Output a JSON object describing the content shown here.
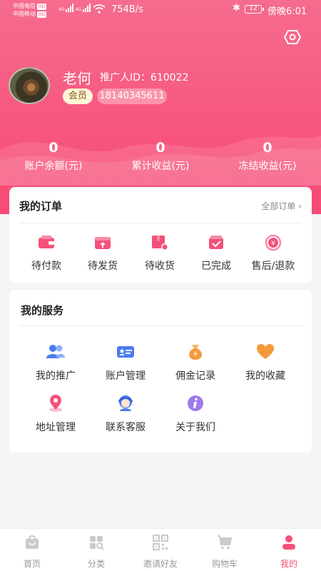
{
  "status_bar": {
    "carrier1": "中国电信",
    "carrier2": "中国移动",
    "hd": "HD",
    "net1": "4G",
    "net2": "4G",
    "speed": "754B/s",
    "battery": "12",
    "time": "傍晚6:01"
  },
  "profile": {
    "nickname": "老何",
    "promoter_label": "推广人ID：",
    "promoter_id": "610022",
    "member_badge": "会员",
    "phone": "18140345611"
  },
  "stats": [
    {
      "value": "0",
      "label": "账户余额(元)"
    },
    {
      "value": "0",
      "label": "累计收益(元)"
    },
    {
      "value": "0",
      "label": "冻结收益(元)"
    }
  ],
  "orders": {
    "title": "我的订单",
    "all_label": "全部订单",
    "items": [
      {
        "label": "待付款",
        "icon": "wallet-icon"
      },
      {
        "label": "待发货",
        "icon": "box-upload-icon"
      },
      {
        "label": "待收货",
        "icon": "package-receive-icon"
      },
      {
        "label": "已完成",
        "icon": "box-check-icon"
      },
      {
        "label": "售后/退款",
        "icon": "refund-icon"
      }
    ]
  },
  "services": {
    "title": "我的服务",
    "items": [
      {
        "label": "我的推广",
        "icon": "users-icon"
      },
      {
        "label": "账户管理",
        "icon": "id-card-icon"
      },
      {
        "label": "佣金记录",
        "icon": "money-bag-icon"
      },
      {
        "label": "我的收藏",
        "icon": "heart-icon"
      },
      {
        "label": "地址管理",
        "icon": "location-pin-icon"
      },
      {
        "label": "联系客服",
        "icon": "support-agent-icon"
      },
      {
        "label": "关于我们",
        "icon": "info-icon"
      }
    ]
  },
  "tabbar": {
    "items": [
      {
        "label": "首页",
        "icon": "shopping-bag-icon"
      },
      {
        "label": "分类",
        "icon": "category-grid-icon"
      },
      {
        "label": "邀请好友",
        "icon": "qr-code-icon"
      },
      {
        "label": "购物车",
        "icon": "cart-icon"
      },
      {
        "label": "我的",
        "icon": "user-icon"
      }
    ],
    "active": "我的"
  },
  "colors": {
    "brand_pink": "#f4517a",
    "service_blue": "#4a7cf0",
    "service_orange": "#f59a3a",
    "service_purple": "#9b7bea"
  }
}
